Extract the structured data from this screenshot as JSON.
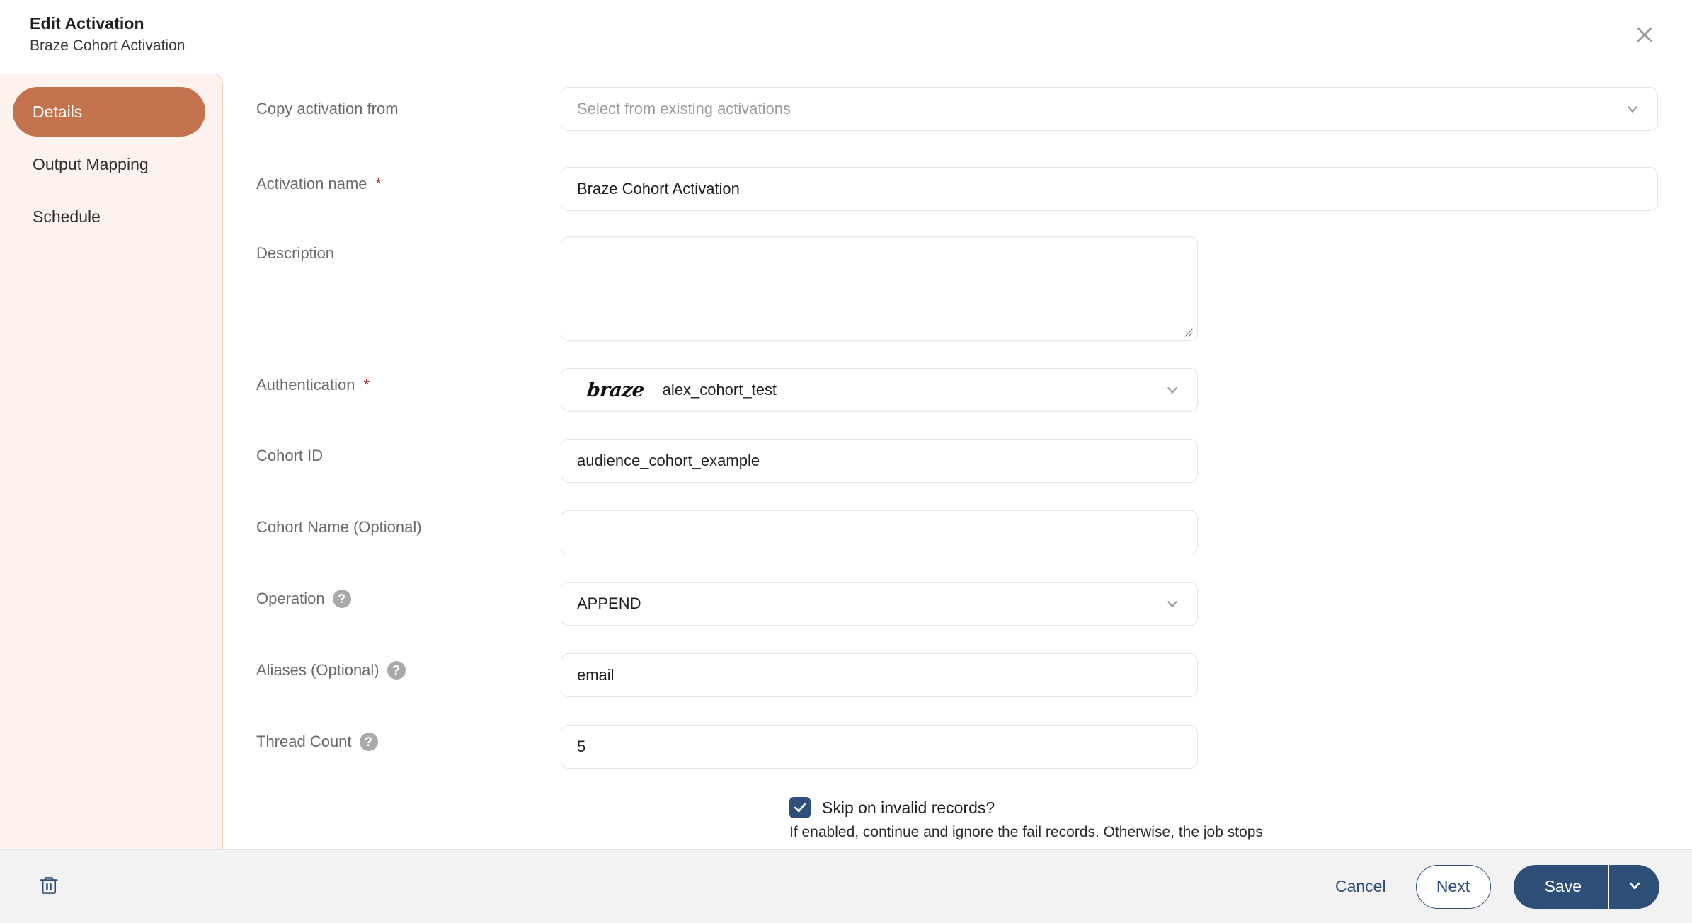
{
  "header": {
    "title": "Edit Activation",
    "subtitle": "Braze Cohort Activation",
    "close_icon": "close-icon"
  },
  "sidebar": {
    "items": [
      {
        "label": "Details",
        "active": true
      },
      {
        "label": "Output Mapping",
        "active": false
      },
      {
        "label": "Schedule",
        "active": false
      }
    ]
  },
  "form": {
    "copy_activation": {
      "label": "Copy activation from",
      "placeholder": "Select from existing activations",
      "value": "",
      "icon": "chevron-down-icon"
    },
    "activation_name": {
      "label": "Activation name",
      "required": "*",
      "value": "Braze Cohort Activation"
    },
    "description": {
      "label": "Description",
      "value": "",
      "placeholder": ""
    },
    "authentication": {
      "label": "Authentication",
      "required": "*",
      "logo": "braze",
      "value": "alex_cohort_test",
      "icon": "chevron-down-icon"
    },
    "cohort_id": {
      "label": "Cohort ID",
      "value": "audience_cohort_example"
    },
    "cohort_name": {
      "label": "Cohort Name (Optional)",
      "value": ""
    },
    "operation": {
      "label": "Operation",
      "help_icon": "help-icon",
      "help_glyph": "?",
      "value": "APPEND",
      "icon": "chevron-down-icon"
    },
    "aliases": {
      "label": "Aliases (Optional)",
      "help_icon": "help-icon",
      "help_glyph": "?",
      "value": "email"
    },
    "thread_count": {
      "label": "Thread Count",
      "help_icon": "help-icon",
      "help_glyph": "?",
      "value": "5"
    },
    "skip_invalid": {
      "label": "Skip on invalid records?",
      "checked": true,
      "help_text": "If enabled, continue and ignore the fail records. Otherwise, the job stops"
    }
  },
  "footer": {
    "delete_icon": "trash-icon",
    "cancel_label": "Cancel",
    "next_label": "Next",
    "save_label": "Save",
    "save_caret_icon": "chevron-down-icon"
  },
  "colors": {
    "accent": "#c4734f",
    "sidebar_bg": "#fdf2ee",
    "primary": "#2d4f78",
    "required": "#a32020",
    "footer_bg": "#f2f2f2"
  }
}
